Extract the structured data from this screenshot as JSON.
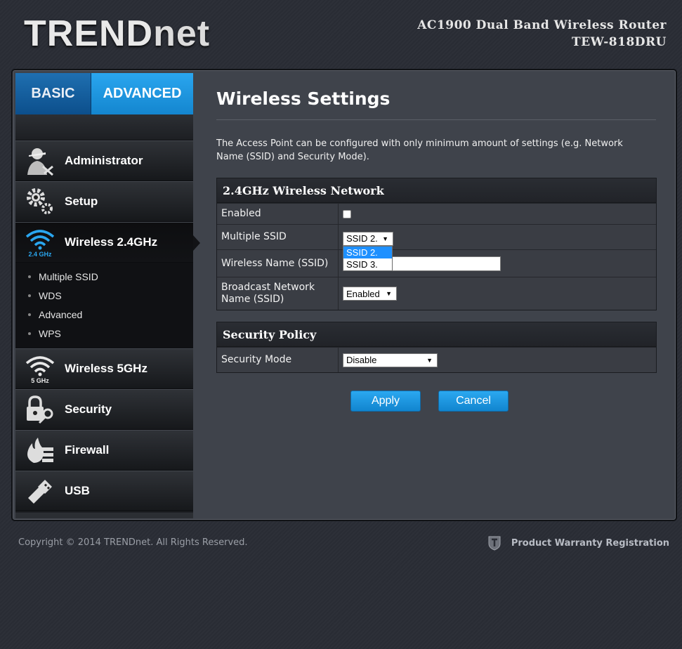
{
  "header": {
    "logo_trend": "TREND",
    "logo_net": "net",
    "product_line1": "AC1900 Dual Band Wireless Router",
    "product_line2": "TEW-818DRU"
  },
  "tabs": {
    "basic": "BASIC",
    "advanced": "ADVANCED"
  },
  "menu": {
    "administrator": "Administrator",
    "setup": "Setup",
    "wireless24": "Wireless 2.4GHz",
    "wireless24_badge": "2.4 GHz",
    "wireless5": "Wireless 5GHz",
    "wireless5_badge": "5 GHz",
    "security": "Security",
    "firewall": "Firewall",
    "usb": "USB",
    "sub": [
      "Multiple SSID",
      "WDS",
      "Advanced",
      "WPS"
    ]
  },
  "page": {
    "title": "Wireless Settings",
    "description": "The Access Point can be configured with only minimum amount of settings (e.g. Network Name (SSID) and Security Mode)."
  },
  "network_panel": {
    "heading": "2.4GHz Wireless Network",
    "enabled_label": "Enabled",
    "enabled_checked": false,
    "multiple_ssid_label": "Multiple SSID",
    "multiple_ssid_value": "SSID 2.",
    "multiple_ssid_options": [
      "SSID 2.",
      "SSID 3."
    ],
    "wireless_name_label": "Wireless Name (SSID)",
    "wireless_name_value": "",
    "broadcast_label_line1": "Broadcast Network",
    "broadcast_label_line2": "Name (SSID)",
    "broadcast_value": "Enabled"
  },
  "security_panel": {
    "heading": "Security Policy",
    "mode_label": "Security Mode",
    "mode_value": "Disable"
  },
  "buttons": {
    "apply": "Apply",
    "cancel": "Cancel"
  },
  "footer": {
    "copyright": "Copyright © 2014 TRENDnet. All Rights Reserved.",
    "warranty": "Product Warranty Registration"
  },
  "colors": {
    "accent": "#1a95e0",
    "background": "#2a2d35",
    "panel": "#3f434b"
  }
}
